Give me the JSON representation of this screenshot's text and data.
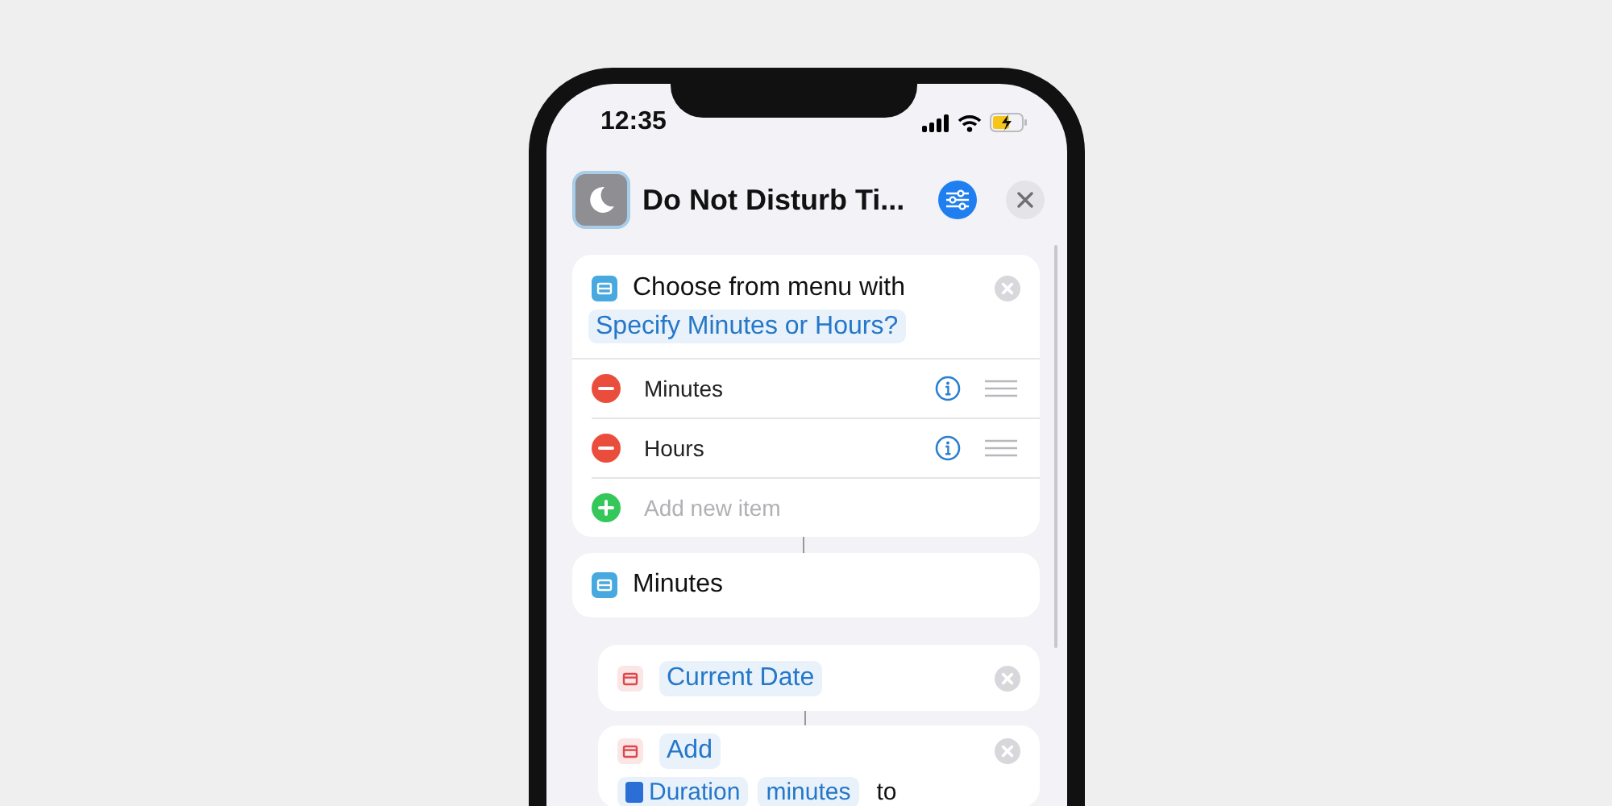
{
  "status_bar": {
    "time": "12:35"
  },
  "header": {
    "title": "Do Not Disturb Ti..."
  },
  "actions": [
    {
      "kind": "menu",
      "indented": false,
      "title": "Choose from menu with",
      "prompt": "Specify Minutes or Hours?",
      "items": [
        {
          "kind": "option",
          "label": "Minutes"
        },
        {
          "kind": "option",
          "label": "Hours"
        },
        {
          "kind": "add",
          "label": "Add new item"
        }
      ]
    },
    {
      "kind": "case",
      "indented": false,
      "title": "Minutes"
    },
    {
      "kind": "action",
      "indented": true,
      "lines": [
        [
          {
            "kind": "token",
            "text": "Current Date"
          }
        ]
      ]
    },
    {
      "kind": "action",
      "indented": true,
      "lines": [
        [
          {
            "kind": "token",
            "text": "Add"
          }
        ],
        [
          {
            "kind": "variable",
            "text": "Duration"
          },
          {
            "kind": "token",
            "text": "minutes"
          },
          {
            "kind": "plain",
            "text": "to"
          }
        ]
      ]
    }
  ]
}
